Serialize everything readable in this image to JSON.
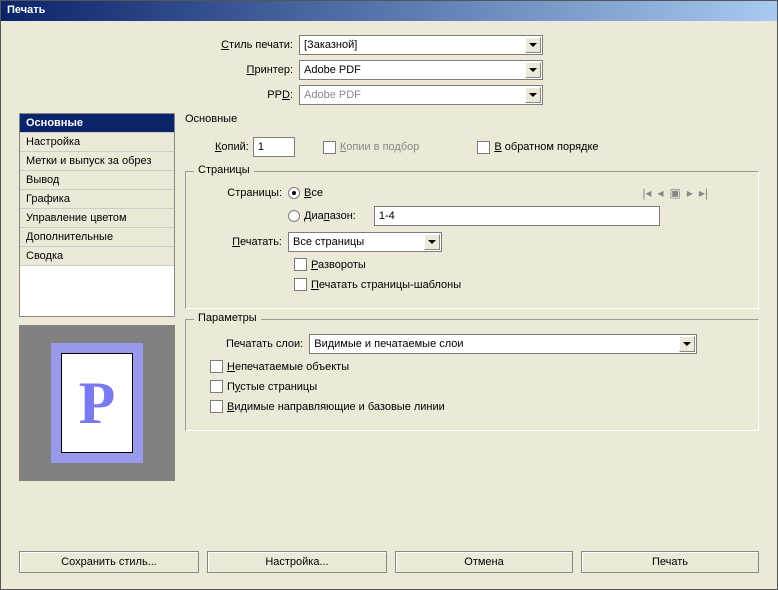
{
  "title": "Печать",
  "top": {
    "style_label": "Стиль печати:",
    "style_value": "[Заказной]",
    "printer_label": "Принтер:",
    "printer_value": "Adobe PDF",
    "ppd_label": "PPD:",
    "ppd_value": "Adobe PDF"
  },
  "sidebar": {
    "items": [
      "Основные",
      "Настройка",
      "Метки и выпуск за обрез",
      "Вывод",
      "Графика",
      "Управление цветом",
      "Дополнительные",
      "Сводка"
    ]
  },
  "panel": {
    "heading": "Основные",
    "copies_label": "Копий:",
    "copies_value": "1",
    "collate_label": "Копии в подбор",
    "reverse_label": "В обратном порядке"
  },
  "pages": {
    "legend": "Страницы",
    "pages_label": "Страницы:",
    "all_label": "Все",
    "range_label": "Диапазон:",
    "range_value": "1-4",
    "print_label": "Печатать:",
    "print_value": "Все страницы",
    "spreads_label": "Развороты",
    "master_label": "Печатать страницы-шаблоны"
  },
  "params": {
    "legend": "Параметры",
    "layers_label": "Печатать слои:",
    "layers_value": "Видимые и печатаемые слои",
    "nonprint_label": "Непечатаемые объекты",
    "blank_label": "Пустые страницы",
    "guides_label": "Видимые направляющие и базовые линии"
  },
  "buttons": {
    "save_style": "Сохранить стиль...",
    "setup": "Настройка...",
    "cancel": "Отмена",
    "print": "Печать"
  },
  "preview_letter": "P"
}
